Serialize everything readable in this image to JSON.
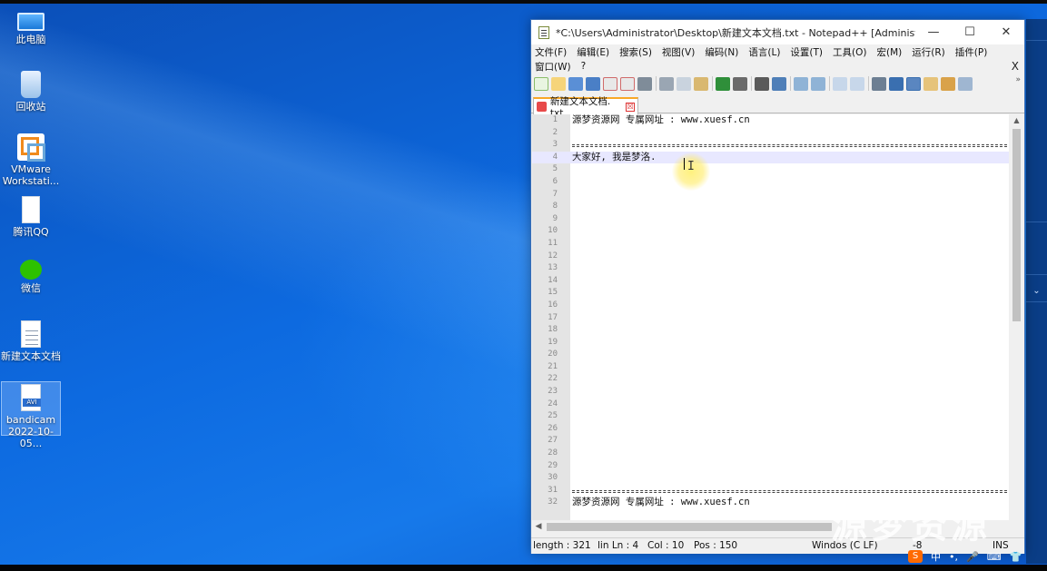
{
  "desktop": {
    "icons": [
      {
        "label": "此电脑",
        "icon": "this-pc-icon"
      },
      {
        "label": "回收站",
        "icon": "recycle-bin-icon"
      },
      {
        "label_line1": "VMware",
        "label_line2": "Workstati...",
        "icon": "vmware-icon"
      },
      {
        "label": "腾讯QQ",
        "icon": "qq-file-icon"
      },
      {
        "label": "微信",
        "icon": "wechat-icon"
      },
      {
        "label": "新建文本文档",
        "icon": "text-document-icon"
      },
      {
        "label_line1": "bandicam",
        "label_line2": "2022-10-05...",
        "icon": "avi-file-icon",
        "badge": "AVI"
      }
    ]
  },
  "window": {
    "title": "*C:\\Users\\Administrator\\Desktop\\新建文本文档.txt - Notepad++ [Administrator]",
    "minimize": "—",
    "maximize": "☐",
    "close": "✕",
    "menu_row1": [
      "文件(F)",
      "编辑(E)",
      "搜索(S)",
      "视图(V)",
      "编码(N)",
      "语言(L)",
      "设置(T)",
      "工具(O)",
      "宏(M)",
      "运行(R)",
      "插件(P)"
    ],
    "menu_row2": [
      "窗口(W)",
      "?"
    ],
    "menu_close": "X",
    "toolbar_more": "»",
    "tab": {
      "label": "新建文本文档. txt",
      "close": "☒"
    },
    "lines": [
      {
        "n": "1",
        "text": "源梦资源网 专属网址 :  www.xuesf.cn"
      },
      {
        "n": "2",
        "text": ""
      },
      {
        "n": "3",
        "text": "",
        "rule": true
      },
      {
        "n": "4",
        "text": "大家好, 我是梦洛.",
        "current": true
      },
      {
        "n": "5",
        "text": ""
      },
      {
        "n": "6",
        "text": ""
      },
      {
        "n": "7",
        "text": ""
      },
      {
        "n": "8",
        "text": ""
      },
      {
        "n": "9",
        "text": ""
      },
      {
        "n": "10",
        "text": ""
      },
      {
        "n": "11",
        "text": ""
      },
      {
        "n": "12",
        "text": ""
      },
      {
        "n": "13",
        "text": ""
      },
      {
        "n": "14",
        "text": ""
      },
      {
        "n": "15",
        "text": ""
      },
      {
        "n": "16",
        "text": ""
      },
      {
        "n": "17",
        "text": ""
      },
      {
        "n": "18",
        "text": ""
      },
      {
        "n": "19",
        "text": ""
      },
      {
        "n": "20",
        "text": ""
      },
      {
        "n": "21",
        "text": ""
      },
      {
        "n": "22",
        "text": ""
      },
      {
        "n": "23",
        "text": ""
      },
      {
        "n": "24",
        "text": ""
      },
      {
        "n": "25",
        "text": ""
      },
      {
        "n": "26",
        "text": ""
      },
      {
        "n": "27",
        "text": ""
      },
      {
        "n": "28",
        "text": ""
      },
      {
        "n": "29",
        "text": ""
      },
      {
        "n": "30",
        "text": ""
      },
      {
        "n": "31",
        "text": "",
        "rule": true
      },
      {
        "n": "32",
        "text": "源梦资源网 专属网址 :  www.xuesf.cn"
      }
    ],
    "ibeam": "I",
    "status": {
      "length": "length : 321",
      "ln": "lin Ln : 4",
      "col": "Col : 10",
      "pos": "Pos : 150",
      "eol": "Windo",
      "eol_rest": "s (C  LF)",
      "enc": "-8",
      "ins": "INS"
    }
  },
  "tray": {
    "ime": "S",
    "lang": "中",
    "punct": "•,"
  },
  "watermark": "源梦资源"
}
